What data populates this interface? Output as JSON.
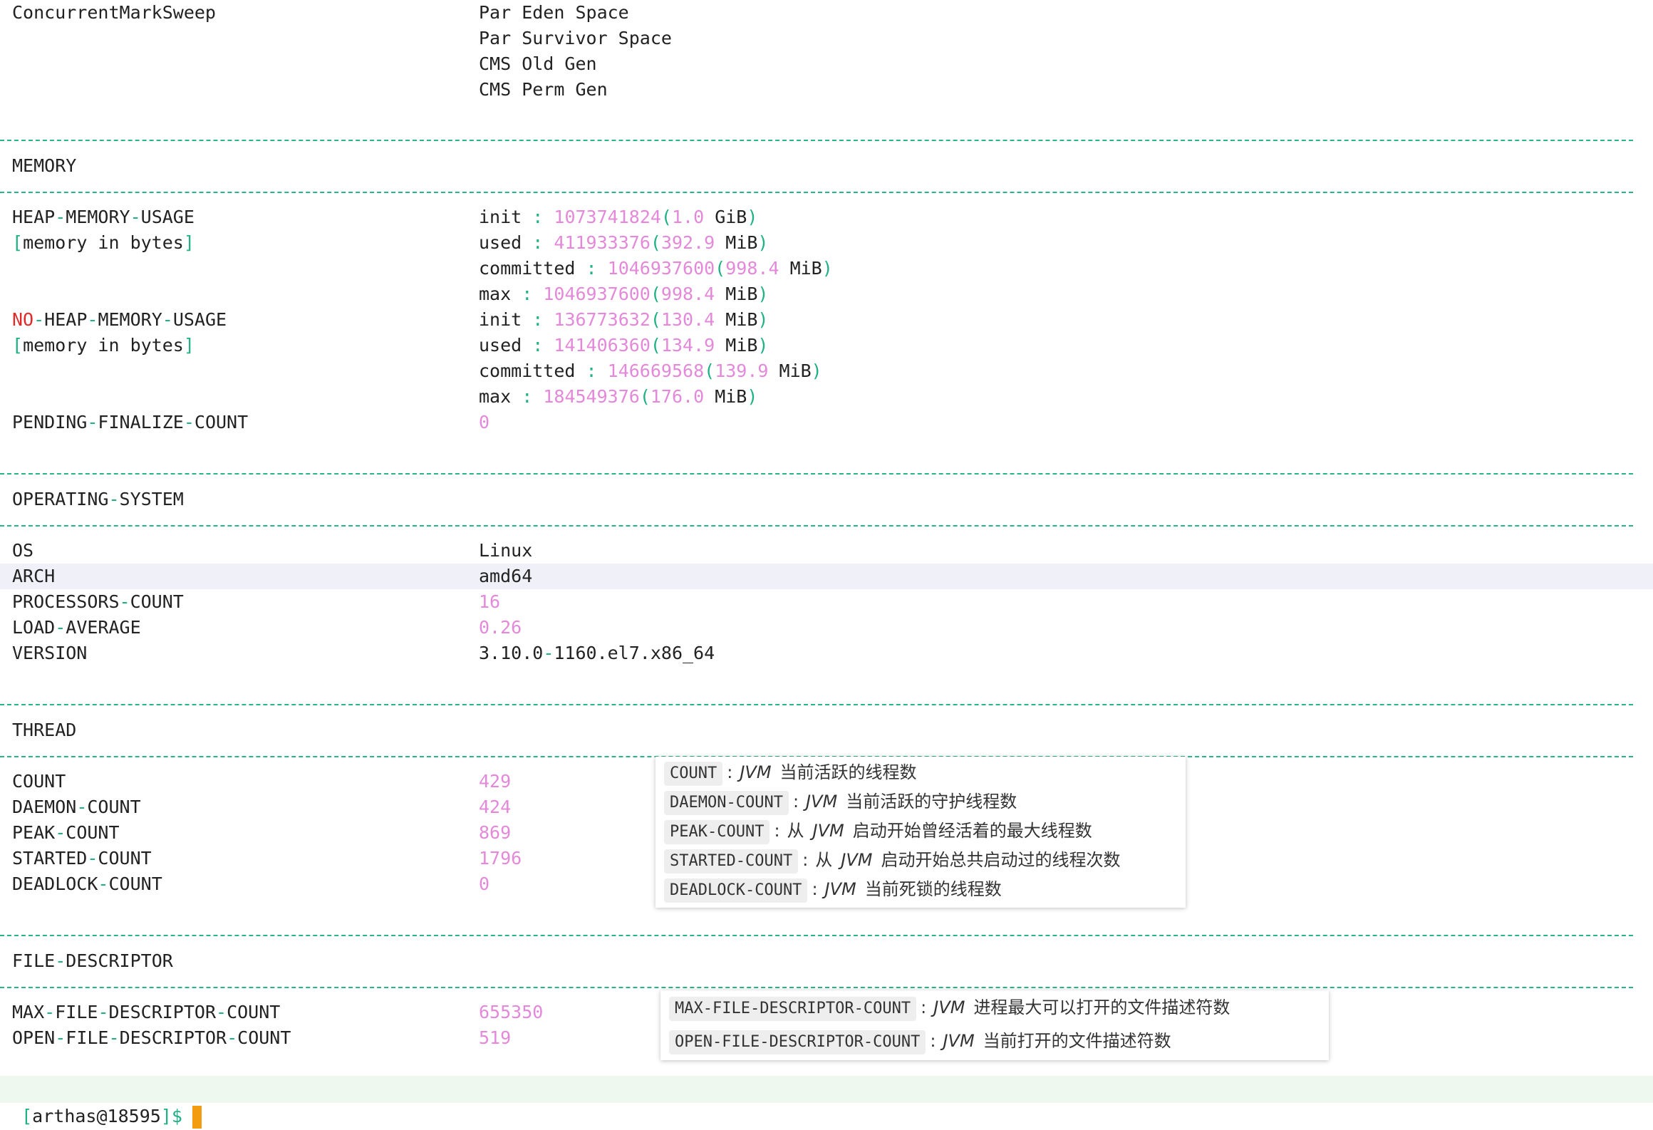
{
  "gc": {
    "name": "ConcurrentMarkSweep",
    "pools": [
      "Par Eden Space",
      "Par Survivor Space",
      "CMS Old Gen",
      "CMS Perm Gen"
    ]
  },
  "memory": {
    "title": "MEMORY",
    "heap_label": [
      "HEAP",
      "MEMORY",
      "USAGE"
    ],
    "bytes_note": "memory in bytes",
    "heap": [
      {
        "key": "init",
        "bytes": "1073741824",
        "num": "1.0",
        "unit": "GiB"
      },
      {
        "key": "used",
        "bytes": "411933376",
        "num": "392.9",
        "unit": "MiB"
      },
      {
        "key": "committed",
        "bytes": "1046937600",
        "num": "998.4",
        "unit": "MiB"
      },
      {
        "key": "max",
        "bytes": "1046937600",
        "num": "998.4",
        "unit": "MiB"
      }
    ],
    "noheap_prefix": "NO",
    "noheap_label": [
      "HEAP",
      "MEMORY",
      "USAGE"
    ],
    "noheap": [
      {
        "key": "init",
        "bytes": "136773632",
        "num": "130.4",
        "unit": "MiB"
      },
      {
        "key": "used",
        "bytes": "141406360",
        "num": "134.9",
        "unit": "MiB"
      },
      {
        "key": "committed",
        "bytes": "146669568",
        "num": "139.9",
        "unit": "MiB"
      },
      {
        "key": "max",
        "bytes": "184549376",
        "num": "176.0",
        "unit": "MiB"
      }
    ],
    "pending_label": [
      "PENDING",
      "FINALIZE",
      "COUNT"
    ],
    "pending_value": "0"
  },
  "os": {
    "title": [
      "OPERATING",
      "SYSTEM"
    ],
    "os_label": "OS",
    "os_value": "Linux",
    "arch_label": "ARCH",
    "arch_value": "amd64",
    "proc_label": [
      "PROCESSORS",
      "COUNT"
    ],
    "proc_value": "16",
    "load_label": [
      "LOAD",
      "AVERAGE"
    ],
    "load_value": "0.26",
    "version_label": "VERSION",
    "version_value": [
      "3.10.0",
      "1160.el7.x86_64"
    ]
  },
  "thread": {
    "title": "THREAD",
    "count_label": "COUNT",
    "count_value": "429",
    "daemon_label": [
      "DAEMON",
      "COUNT"
    ],
    "daemon_value": "424",
    "peak_label": [
      "PEAK",
      "COUNT"
    ],
    "peak_value": "869",
    "started_label": [
      "STARTED",
      "COUNT"
    ],
    "started_value": "1796",
    "deadlock_label": [
      "DEADLOCK",
      "COUNT"
    ],
    "deadlock_value": "0"
  },
  "fd": {
    "title": [
      "FILE",
      "DESCRIPTOR"
    ],
    "max_label": [
      "MAX",
      "FILE",
      "DESCRIPTOR",
      "COUNT"
    ],
    "max_value": "655350",
    "open_label": [
      "OPEN",
      "FILE",
      "DESCRIPTOR",
      "COUNT"
    ],
    "open_value": "519"
  },
  "thread_tooltip": [
    {
      "code": "COUNT",
      "pre": "",
      "jvm": "JVM",
      "text": "当前活跃的线程数"
    },
    {
      "code": "DAEMON-COUNT",
      "pre": "",
      "jvm": "JVM",
      "text": "当前活跃的守护线程数"
    },
    {
      "code": "PEAK-COUNT",
      "pre": "从",
      "jvm": "JVM",
      "text": "启动开始曾经活着的最大线程数"
    },
    {
      "code": "STARTED-COUNT",
      "pre": "从",
      "jvm": "JVM",
      "text": "启动开始总共启动过的线程次数"
    },
    {
      "code": "DEADLOCK-COUNT",
      "pre": "",
      "jvm": "JVM",
      "text": "当前死锁的线程数"
    }
  ],
  "fd_tooltip": [
    {
      "code": "MAX-FILE-DESCRIPTOR-COUNT",
      "pre": "",
      "jvm": "JVM",
      "text": "进程最大可以打开的文件描述符数"
    },
    {
      "code": "OPEN-FILE-DESCRIPTOR-COUNT",
      "pre": "",
      "jvm": "JVM",
      "text": "当前打开的文件描述符数"
    }
  ],
  "prompt": {
    "user": "arthas",
    "pid": "18595",
    "symbol": "$"
  },
  "symbols": {
    "dash": "-",
    "colon": ":",
    "lparen": "(",
    "rparen": ")",
    "lbracket": "[",
    "rbracket": "]",
    "at": "@"
  },
  "colors": {
    "accent_green": "#1fb083",
    "number_magenta": "#e489da",
    "warn_red": "#e02a2a",
    "cursor_orange": "#f39c12"
  }
}
